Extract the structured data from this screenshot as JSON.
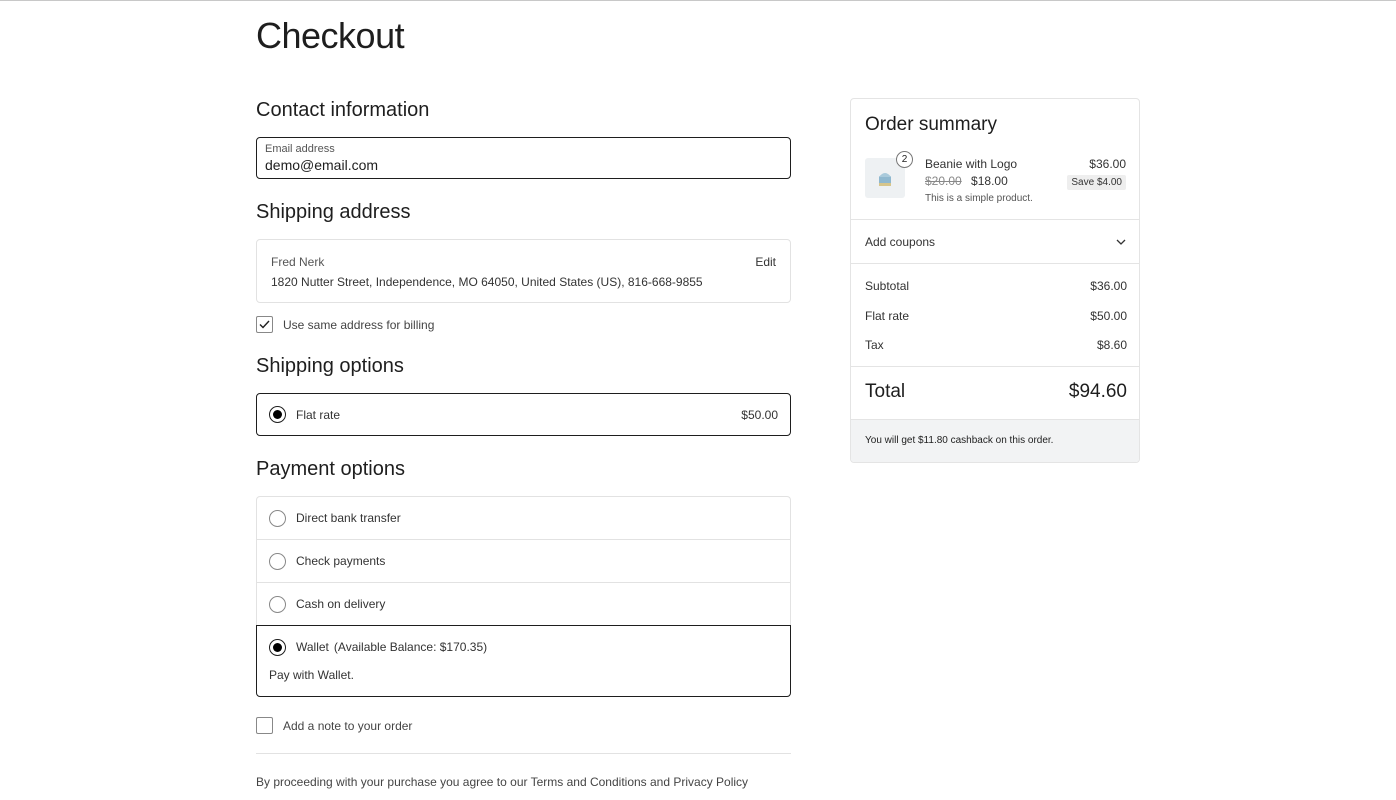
{
  "page": {
    "title": "Checkout"
  },
  "contact": {
    "heading": "Contact information",
    "email_label": "Email address",
    "email_value": "demo@email.com"
  },
  "shipping_address": {
    "heading": "Shipping address",
    "name": "Fred Nerk",
    "address": "1820 Nutter Street, Independence, MO 64050, United States (US), 816-668-9855",
    "edit_label": "Edit",
    "same_billing_label": "Use same address for billing",
    "same_billing_checked": true
  },
  "shipping_options": {
    "heading": "Shipping options",
    "options": [
      {
        "label": "Flat rate",
        "price": "$50.00",
        "selected": true
      }
    ]
  },
  "payment_options": {
    "heading": "Payment options",
    "methods": [
      {
        "label": "Direct bank transfer",
        "selected": false
      },
      {
        "label": "Check payments",
        "selected": false
      },
      {
        "label": "Cash on delivery",
        "selected": false
      }
    ],
    "wallet": {
      "label": "Wallet",
      "balance": "(Available Balance: $170.35)",
      "description": "Pay with Wallet.",
      "selected": true
    }
  },
  "order_note": {
    "label": "Add a note to your order",
    "checked": false
  },
  "terms": {
    "text": "By proceeding with your purchase you agree to our Terms and Conditions and Privacy Policy"
  },
  "summary": {
    "heading": "Order summary",
    "item": {
      "quantity": "2",
      "name": "Beanie with Logo",
      "regular_price": "$20.00",
      "sale_price": "$18.00",
      "description": "This is a simple product.",
      "line_total": "$36.00",
      "save": "Save $4.00",
      "image_icon": "beanie-image"
    },
    "coupons_label": "Add coupons",
    "subtotal_label": "Subtotal",
    "subtotal_value": "$36.00",
    "shipping_label": "Flat rate",
    "shipping_value": "$50.00",
    "tax_label": "Tax",
    "tax_value": "$8.60",
    "total_label": "Total",
    "total_value": "$94.60",
    "cashback_text": "You will get $11.80 cashback on this order."
  }
}
